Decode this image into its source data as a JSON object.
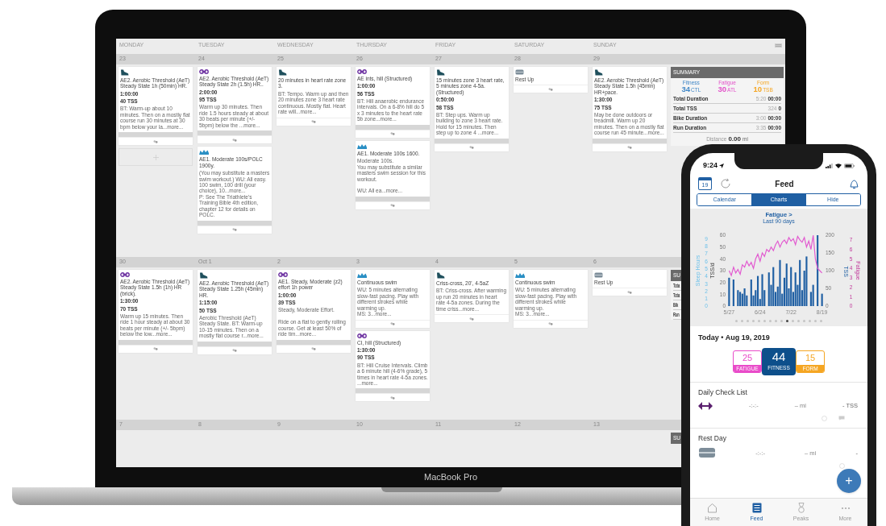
{
  "laptop": {
    "brand": "MacBook Pro",
    "calendar": {
      "weekdays": [
        "MONDAY",
        "TUESDAY",
        "WEDNESDAY",
        "THURSDAY",
        "FRIDAY",
        "SATURDAY",
        "SUNDAY"
      ],
      "weeks": [
        {
          "days": [
            {
              "date": "23",
              "add_slot": true,
              "workouts": [
                {
                  "kind": "run",
                  "title": "AE2. Aerobic Threshold (AeT) Steady State 1h (50min) HR.",
                  "duration": "1:00:00",
                  "tss": "40 TSS",
                  "description": "BT: Warm-up about 10 minutes. Then on a mostly flat course run 30 minutes at 30 bpm below your la...more...",
                  "graph": true
                }
              ]
            },
            {
              "date": "24",
              "workouts": [
                {
                  "kind": "bike",
                  "title": "AE2. Aerobic Threshold (AeT) Steady State 2h (1.5h) HR..",
                  "duration": "2:00:00",
                  "tss": "95 TSS",
                  "description": "Warm up 30 minutes. Then ride 1.5 hours steady at about 30 beats per minute (+/- 5bpm) below the ...more...",
                  "graph": true
                },
                {
                  "kind": "swim",
                  "title": "AE1. Moderate 100s/POLC 1900y.",
                  "description": "(You may substitute a masters swim workout.) WU: All easy.\n100 swim, 100 drill (your choice), 10...more...\nP: See The Triathlete's Training Bible 4th edition, chapter 12 for details on POLC.",
                  "graph": true
                }
              ]
            },
            {
              "date": "25",
              "workouts": [
                {
                  "kind": "run",
                  "title": "20 minutes in heart rate zone 3.",
                  "description": "BT: Tempo. Warm up and then 20 minutes zone 3 heart rate continuous. Mostly flat. Heart rate will...more...",
                  "graph": false
                }
              ]
            },
            {
              "date": "26",
              "workouts": [
                {
                  "kind": "bike",
                  "title": "AE ints, hill (Structured)",
                  "duration": "1:00:00",
                  "tss": "56 TSS",
                  "description": "BT: Hill anaerobic endurance intervals. On a 6-8% hill do 5 x 3 minutes to the heart rate 5b zone...more...",
                  "graph": true
                },
                {
                  "kind": "swim",
                  "title": "AE1. Moderate 100s 1600.",
                  "description": "Moderate 100s.\nYou may substitute a similar masters swim session for this workout.\n\nWU: All ea...more...",
                  "graph": true
                }
              ]
            },
            {
              "date": "27",
              "workouts": [
                {
                  "kind": "run",
                  "title": "15 minutes zone 3 heart rate, 5 minutes zone 4-5a. (Structured)",
                  "duration": "0:50:00",
                  "tss": "58 TSS",
                  "description": "BT: Step ups. Warm up building to zone 3 heart rate. Hold for 15 minutes. Then step up to zone 4 ...more...",
                  "graph": true
                }
              ]
            },
            {
              "date": "28",
              "workouts": [
                {
                  "kind": "rest",
                  "title": "Rest Up",
                  "graph": false
                }
              ]
            },
            {
              "date": "29",
              "workouts": [
                {
                  "kind": "run",
                  "title": "AE2. Aerobic Threshold (AeT) Steady State 1.5h (45min) HR+pace.",
                  "duration": "1:30:00",
                  "tss": "75 TSS",
                  "description": "May be done outdoors or treadmill. Warm up 20 minutes. Then on a mostly flat course run 45 minute...more...",
                  "graph": true
                }
              ]
            }
          ],
          "summary": {
            "title": "SUMMARY",
            "metrics": [
              {
                "label": "Fitness",
                "value": "34",
                "unit": "CTL",
                "color": "#3f86c6"
              },
              {
                "label": "Fatigue",
                "value": "30",
                "unit": "ATL",
                "color": "#e24fc8"
              },
              {
                "label": "Form",
                "value": "10",
                "unit": "TSB",
                "color": "#f5a623"
              }
            ],
            "rows": [
              {
                "label": "Total Duration",
                "planned": "5:20",
                "completed": "00:00"
              },
              {
                "label": "Total TSS",
                "planned": "324",
                "completed": "0"
              },
              {
                "label": "Bike Duration",
                "planned": "3:00",
                "completed": "00:00"
              },
              {
                "label": "Run Duration",
                "planned": "3:35",
                "completed": "00:00"
              }
            ],
            "distance": {
              "label": "Distance",
              "value": "0.00",
              "unit": "mi"
            }
          }
        },
        {
          "days": [
            {
              "date": "30",
              "workouts": [
                {
                  "kind": "bike",
                  "title": "AE2. Aerobic Threshold (AeT) Steady State 1.5h (1h) HR (brick).",
                  "duration": "1:30:00",
                  "tss": "70 TSS",
                  "description": "Warm up 15 minutes. Then ride 1 hour steady at about 30 beats per minute (+/- 5bpm) below the low...more...",
                  "graph": true
                }
              ]
            },
            {
              "date": "Oct 1",
              "workouts": [
                {
                  "kind": "run",
                  "title": "AE2. Aerobic Threshold (AeT) Steady State 1.25h (45min) HR.",
                  "duration": "1:15:00",
                  "tss": "50 TSS",
                  "description": "Aerobic Threshold (AeT) Steady State. BT: Warm-up 10-15 minutes. Then on a mostly flat course r...more...",
                  "graph": true
                }
              ]
            },
            {
              "date": "2",
              "workouts": [
                {
                  "kind": "bike",
                  "title": "AE1. Steady, Moderate (z2) effort 1h power",
                  "duration": "1:00:00",
                  "tss": "39 TSS",
                  "description": "Steady, Moderate Effort.\n\nRide on a flat to gently rolling course. Get at least 50% of ride tim...more...",
                  "graph": true
                }
              ]
            },
            {
              "date": "3",
              "workouts": [
                {
                  "kind": "swim",
                  "title": "Continuous swim",
                  "description": "WU: 5 minutes alternating slow-fast pacing. Play with different strokes while warming up.\nMS: 3...more...",
                  "graph": false
                },
                {
                  "kind": "bike",
                  "title": "CI, hill (Structured)",
                  "duration": "1:30:00",
                  "tss": "90 TSS",
                  "description": "BT: Hill Cruise Intervals. Climb a 6 minute hill (4-6% grade), 5 times in heart rate 4-5a zones. ...more...",
                  "graph": true
                }
              ]
            },
            {
              "date": "4",
              "workouts": [
                {
                  "kind": "run",
                  "title": "Criss-cross, 20', 4-5aZ",
                  "description": "BT: Criss-cross. After warming up run 20 minutes in heart rate 4-5a zones. During the time criss...more...",
                  "graph": false
                }
              ]
            },
            {
              "date": "5",
              "workouts": [
                {
                  "kind": "swim",
                  "title": "Continuous swim",
                  "description": "WU: 5 minutes alternating slow-fast pacing. Play with different strokes while warming up.\nMS: 3...more...",
                  "graph": false
                }
              ]
            },
            {
              "date": "6",
              "workouts": [
                {
                  "kind": "rest",
                  "title": "Rest Up",
                  "graph": false
                }
              ]
            }
          ],
          "summary": {
            "title": "SU",
            "rows": [
              {
                "label": "Tota"
              },
              {
                "label": "Tota"
              },
              {
                "label": "Bik"
              },
              {
                "label": "Run"
              }
            ]
          }
        },
        {
          "days": [
            {
              "date": "7"
            },
            {
              "date": "8"
            },
            {
              "date": "9"
            },
            {
              "date": "10"
            },
            {
              "date": "11"
            },
            {
              "date": "12"
            },
            {
              "date": "13"
            }
          ],
          "summary": {
            "title": "SU"
          }
        }
      ]
    }
  },
  "phone": {
    "time": "9:24",
    "calendar_day": "19",
    "title": "Feed",
    "tabs": [
      {
        "label": "Calendar",
        "selected": false
      },
      {
        "label": "Charts",
        "selected": true
      },
      {
        "label": "Hide",
        "selected": false
      }
    ],
    "chart": {
      "title": "Fatigue >",
      "subtitle": "Last 90 days",
      "extra_axes": [
        {
          "label": "Sleep Hours",
          "ticks": [
            "9",
            "8",
            "7",
            "6",
            "5",
            "4",
            "3",
            "2",
            "1",
            "0"
          ]
        },
        {
          "label": "Fatigue",
          "ticks": [
            "7",
            "6",
            "5",
            "4",
            "3",
            "2",
            "1",
            "0"
          ]
        }
      ],
      "chart_data": {
        "type": "bar",
        "ylabel": "TSS",
        "ylim": [
          0,
          200
        ],
        "yticks": [
          0,
          50,
          100,
          150,
          200
        ],
        "categories": [
          "5/27",
          null,
          null,
          null,
          null,
          null,
          null,
          null,
          null,
          null,
          null,
          null,
          null,
          null,
          "6/24",
          null,
          null,
          null,
          null,
          null,
          null,
          null,
          null,
          null,
          null,
          null,
          null,
          null,
          "7/22",
          null,
          null,
          null,
          null,
          null,
          null,
          null,
          null,
          null,
          null,
          null,
          null,
          null,
          "8/19"
        ],
        "series": [
          {
            "color": "#1f5fa3",
            "values": [
              80,
              null,
              75,
              null,
              45,
              40,
              35,
              50,
              30,
              null,
              75,
              30,
              45,
              85,
              20,
              90,
              45,
              null,
              95,
              60,
              110,
              40,
              55,
              130,
              35,
              80,
              120,
              50,
              110,
              40,
              95,
              60,
              130,
              45,
              100,
              140,
              null,
              40,
              60,
              null,
              200,
              null,
              35
            ]
          }
        ]
      },
      "line_chart": {
        "chart_data": {
          "type": "line",
          "ylabel": "TSS/d",
          "ylim": [
            0,
            60
          ],
          "yticks": [
            0,
            10,
            20,
            30,
            40,
            50,
            60
          ],
          "series": [
            {
              "color": "#e25bd0",
              "values": [
                30,
                26,
                33,
                28,
                31,
                27,
                35,
                33,
                38,
                34,
                37,
                32,
                40,
                44,
                38,
                45,
                42,
                48,
                46,
                50,
                47,
                52,
                55,
                50,
                54,
                56,
                53,
                58,
                55,
                57,
                52,
                59,
                56,
                54,
                58,
                50,
                55,
                48,
                60,
                40,
                32,
                30,
                28
              ]
            }
          ]
        }
      },
      "page_dots": [
        {
          "selected": false
        },
        {
          "selected": false
        },
        {
          "selected": false
        },
        {
          "selected": false
        },
        {
          "selected": false
        },
        {
          "selected": false
        },
        {
          "selected": false
        },
        {
          "selected": false
        },
        {
          "selected": false
        },
        {
          "selected": true
        },
        {
          "selected": false
        },
        {
          "selected": false
        },
        {
          "selected": false
        },
        {
          "selected": false
        },
        {
          "selected": false
        },
        {
          "selected": false
        }
      ]
    },
    "today": "Today • Aug 19, 2019",
    "tiles": [
      {
        "value": "25",
        "label": "FATIGUE",
        "color": "#e94bc9",
        "selected": false
      },
      {
        "value": "44",
        "label": "FITNESS",
        "color": "#0d4f8b",
        "selected": true
      },
      {
        "value": "15",
        "label": "FORM",
        "color": "#f5a623",
        "selected": false
      }
    ],
    "sections": [
      {
        "title": "Daily Check List",
        "kind": "strength",
        "time": "-:-:-",
        "distance": "– mi",
        "tss": "- TSS"
      },
      {
        "title": "Rest Day",
        "kind": "rest",
        "time": "-:-:-",
        "distance": "– mi",
        "tss": "-"
      }
    ],
    "fab": "+",
    "nav": [
      {
        "kind": "home",
        "label": "Home",
        "selected": false
      },
      {
        "kind": "feed",
        "label": "Feed",
        "selected": true
      },
      {
        "kind": "peaks",
        "label": "Peaks",
        "selected": false
      },
      {
        "kind": "more",
        "label": "More",
        "selected": false
      }
    ]
  }
}
